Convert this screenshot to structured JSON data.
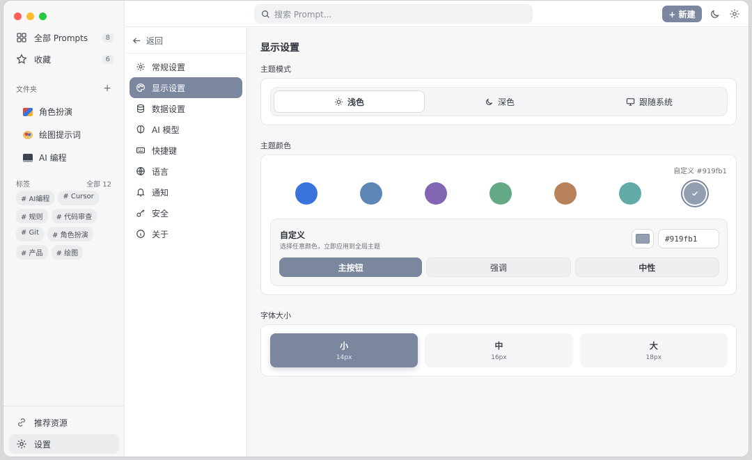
{
  "sidebar": {
    "all_prompts_label": "全部 Prompts",
    "all_prompts_count": "8",
    "favorites_label": "收藏",
    "favorites_count": "6",
    "folders_heading": "文件夹",
    "folders_add": "+",
    "folders": [
      "角色扮演",
      "绘图提示词",
      "AI 编程"
    ],
    "tags_heading": "标签",
    "tags_all": "全部 12",
    "tags": [
      "# AI编程",
      "# Cursor",
      "# 规则",
      "# 代码审查",
      "# Git",
      "# 角色扮演",
      "# 产品",
      "# 绘图"
    ],
    "resources_label": "推荐资源",
    "settings_label": "设置"
  },
  "topbar": {
    "search_placeholder": "搜索 Prompt...",
    "new_label": "+ 新建"
  },
  "settings_nav": {
    "back_label": "返回",
    "items": [
      "常规设置",
      "显示设置",
      "数据设置",
      "AI 模型",
      "快捷键",
      "语言",
      "通知",
      "安全",
      "关于"
    ]
  },
  "display": {
    "title": "显示设置",
    "theme_mode_label": "主题模式",
    "theme_modes": [
      "浅色",
      "深色",
      "跟随系统"
    ],
    "theme_color_label": "主题颜色",
    "custom_hex_label": "自定义 #919fb1",
    "swatches": [
      "#3b73dd",
      "#5d86b5",
      "#8266b3",
      "#64a985",
      "#b7825a",
      "#63aba7",
      "#919fb1"
    ],
    "custom_title": "自定义",
    "custom_desc": "选择任意颜色，立即应用到全局主题",
    "custom_value": "#919fb1",
    "preview_buttons": [
      "主按钮",
      "强调",
      "中性"
    ],
    "font_size_label": "字体大小",
    "font_sizes": [
      {
        "label": "小",
        "size": "14px"
      },
      {
        "label": "中",
        "size": "16px"
      },
      {
        "label": "大",
        "size": "18px"
      }
    ]
  }
}
